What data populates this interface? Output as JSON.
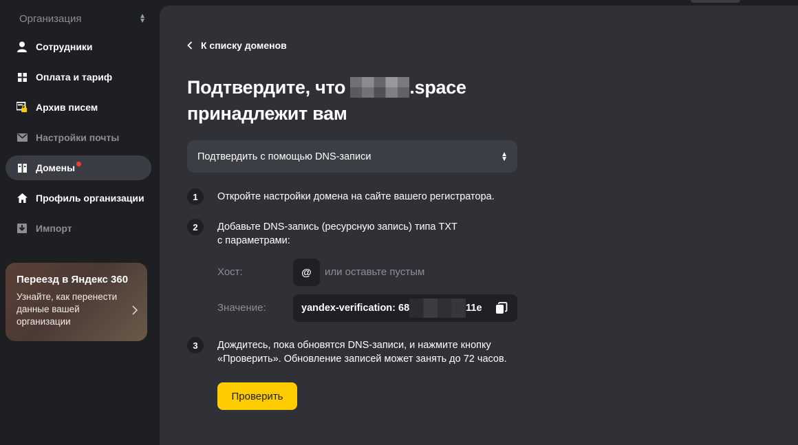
{
  "sidebar": {
    "org_switch_label": "Организация",
    "items": [
      {
        "label": "Сотрудники",
        "icon": "person-icon"
      },
      {
        "label": "Оплата и тариф",
        "icon": "grid-icon"
      },
      {
        "label": "Архив писем",
        "icon": "archive-lock-icon"
      },
      {
        "label": "Настройки почты",
        "icon": "mail-icon"
      },
      {
        "label": "Домены",
        "icon": "domains-icon",
        "active": true,
        "has_notification_dot": true
      },
      {
        "label": "Профиль организации",
        "icon": "home-icon"
      },
      {
        "label": "Импорт",
        "icon": "import-icon"
      }
    ],
    "promo": {
      "title": "Переезд в Яндекс 360",
      "text": "Узнайте, как перенести данные вашей организации"
    }
  },
  "main": {
    "back_link": "К списку доменов",
    "title_prefix": "Подтвердите, что",
    "title_domain_suffix": ".space",
    "title_line2": "принадлежит вам",
    "method_select": "Подтвердить с помощью DNS-записи",
    "steps": [
      {
        "num": "1",
        "text": "Откройте настройки домена на сайте вашего регистратора."
      },
      {
        "num": "2",
        "text_line1": "Добавьте DNS-запись (ресурсную запись) типа TXT",
        "text_line2": "с параметрами:"
      },
      {
        "num": "3",
        "text_line1": "Дождитесь, пока обновятся DNS-записи, и нажмите кнопку",
        "text_line2": "«Проверить». Обновление записей может занять до 72 часов."
      }
    ],
    "host_label": "Хост:",
    "host_value": "@",
    "host_hint": "или оставьте пустым",
    "value_label": "Значение:",
    "value_prefix": "yandex-verification: 68",
    "value_suffix": "11e",
    "check_button": "Проверить"
  },
  "colors": {
    "background": "#1e1f22",
    "panel": "#2f3136",
    "accent_button": "#ffcc00",
    "notification_dot": "#ff3b30"
  }
}
